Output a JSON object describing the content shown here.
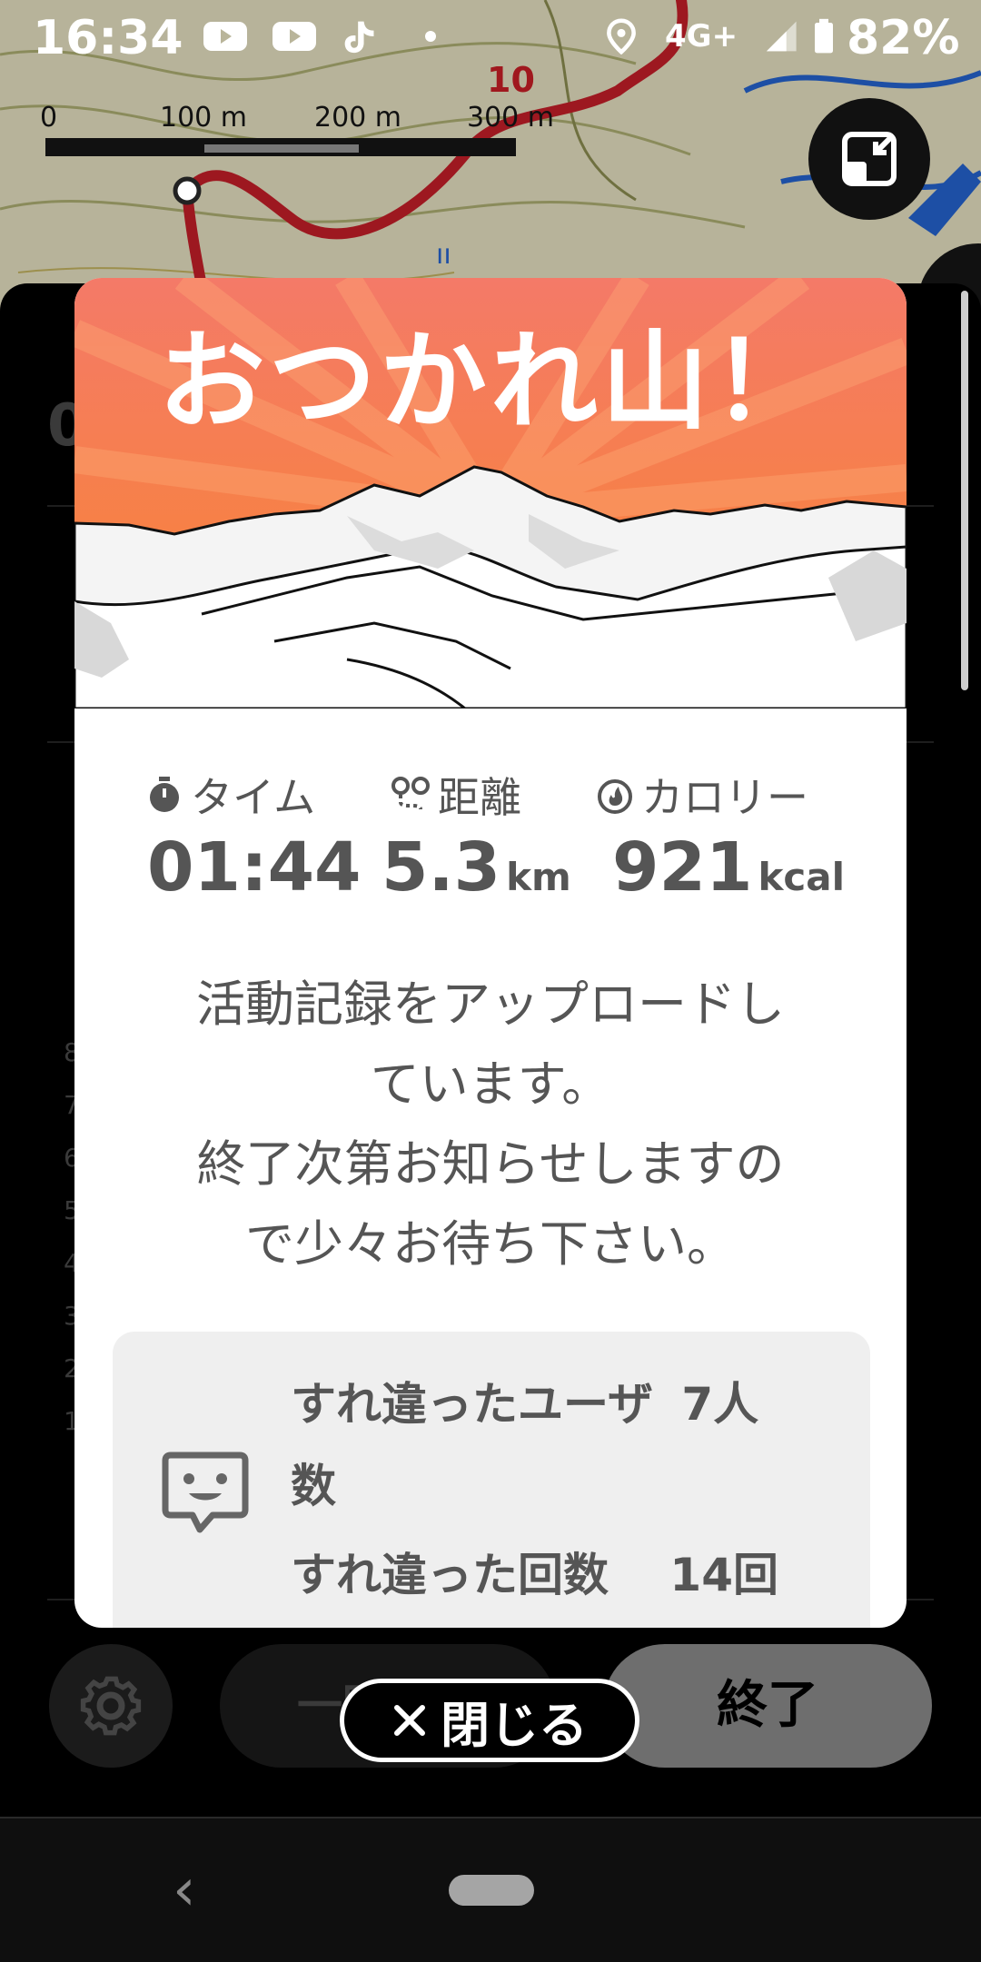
{
  "status_bar": {
    "time": "16:34",
    "network": "4G+",
    "battery": "82%"
  },
  "map": {
    "scale_labels": [
      "0",
      "100 m",
      "200 m",
      "300 m"
    ],
    "marker_label": "10"
  },
  "background_sheet": {
    "ghost_text": "0",
    "ticks": [
      "8",
      "7",
      "6",
      "5",
      "4",
      "3",
      "2",
      "1"
    ]
  },
  "modal": {
    "title": "おつかれ山！",
    "stats": {
      "time": {
        "label": "タイム",
        "value": "01:44",
        "unit": ""
      },
      "distance": {
        "label": "距離",
        "value": "5.3",
        "unit": "km"
      },
      "calories": {
        "label": "カロリー",
        "value": "921",
        "unit": "kcal"
      }
    },
    "message_lines": [
      "活動記録をアップロードし",
      "ています。",
      "終了次第お知らせしますの",
      "で少々お待ち下さい。"
    ],
    "encounter": {
      "users_label": "すれ違ったユーザ",
      "users_value": "7人",
      "users_suffix": "数",
      "count_label": "すれ違った回数",
      "count_value": "14回"
    }
  },
  "controls": {
    "pause_label": "一時停止",
    "end_label": "終了",
    "close_label": "閉じる"
  },
  "colors": {
    "hero_top": "#f47a68",
    "hero_bottom": "#f9852f",
    "text_gray": "#555555",
    "route_red": "#a0181e"
  }
}
